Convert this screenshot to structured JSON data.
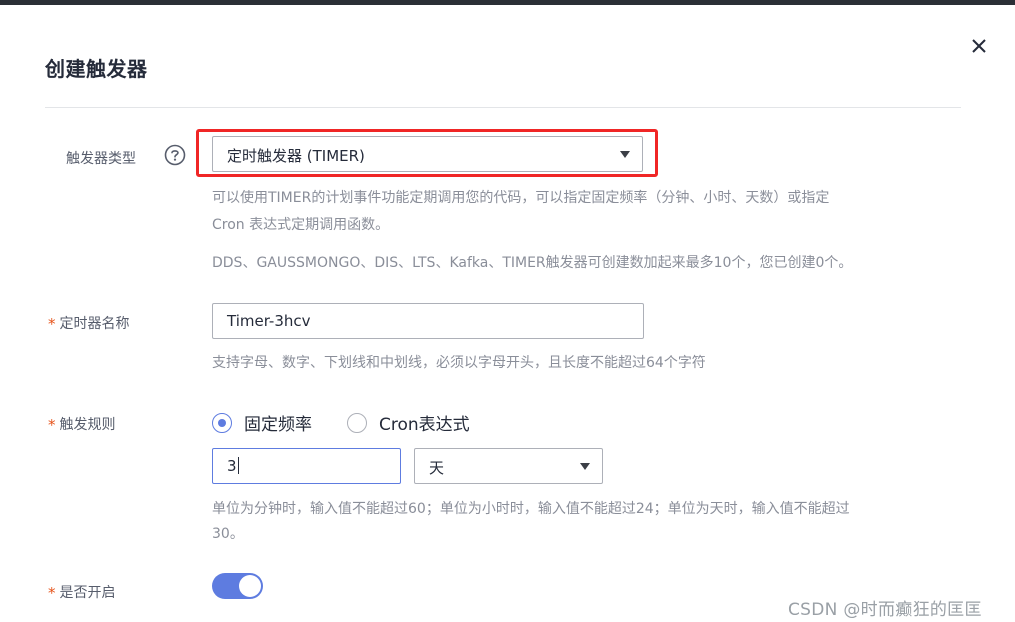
{
  "dialog": {
    "title": "创建触发器",
    "close_icon": "close-icon"
  },
  "trigger_type": {
    "label": "触发器类型",
    "help_icon": "question-circle-icon",
    "selected": "定时触发器 (TIMER)",
    "hint_line1": "可以使用TIMER的计划事件功能定期调用您的代码，可以指定固定频率（分钟、小时、天数）或指定",
    "hint_line2": "Cron 表达式定期调用函数。",
    "hint_line3": "DDS、GAUSSMONGO、DIS、LTS、Kafka、TIMER触发器可创建数加起来最多10个，您已创建0个。"
  },
  "timer_name": {
    "required": "*",
    "label": "定时器名称",
    "value": "Timer-3hcv",
    "hint": "支持字母、数字、下划线和中划线，必须以字母开头，且长度不能超过64个字符"
  },
  "trigger_rule": {
    "required": "*",
    "label": "触发规则",
    "options": [
      {
        "label": "固定频率",
        "checked": true
      },
      {
        "label": "Cron表达式",
        "checked": false
      }
    ],
    "frequency_value": "3",
    "unit_selected": "天",
    "hint_line1": "单位为分钟时，输入值不能超过60；单位为小时时，输入值不能超过24；单位为天时，输入值不能超过",
    "hint_line2": "30。"
  },
  "enabled": {
    "required": "*",
    "label": "是否开启",
    "on": true
  },
  "watermark": "CSDN @时而癫狂的匡匡",
  "colors": {
    "primary": "#5e7ce0",
    "highlight": "#f02626",
    "required": "#e6541c"
  }
}
